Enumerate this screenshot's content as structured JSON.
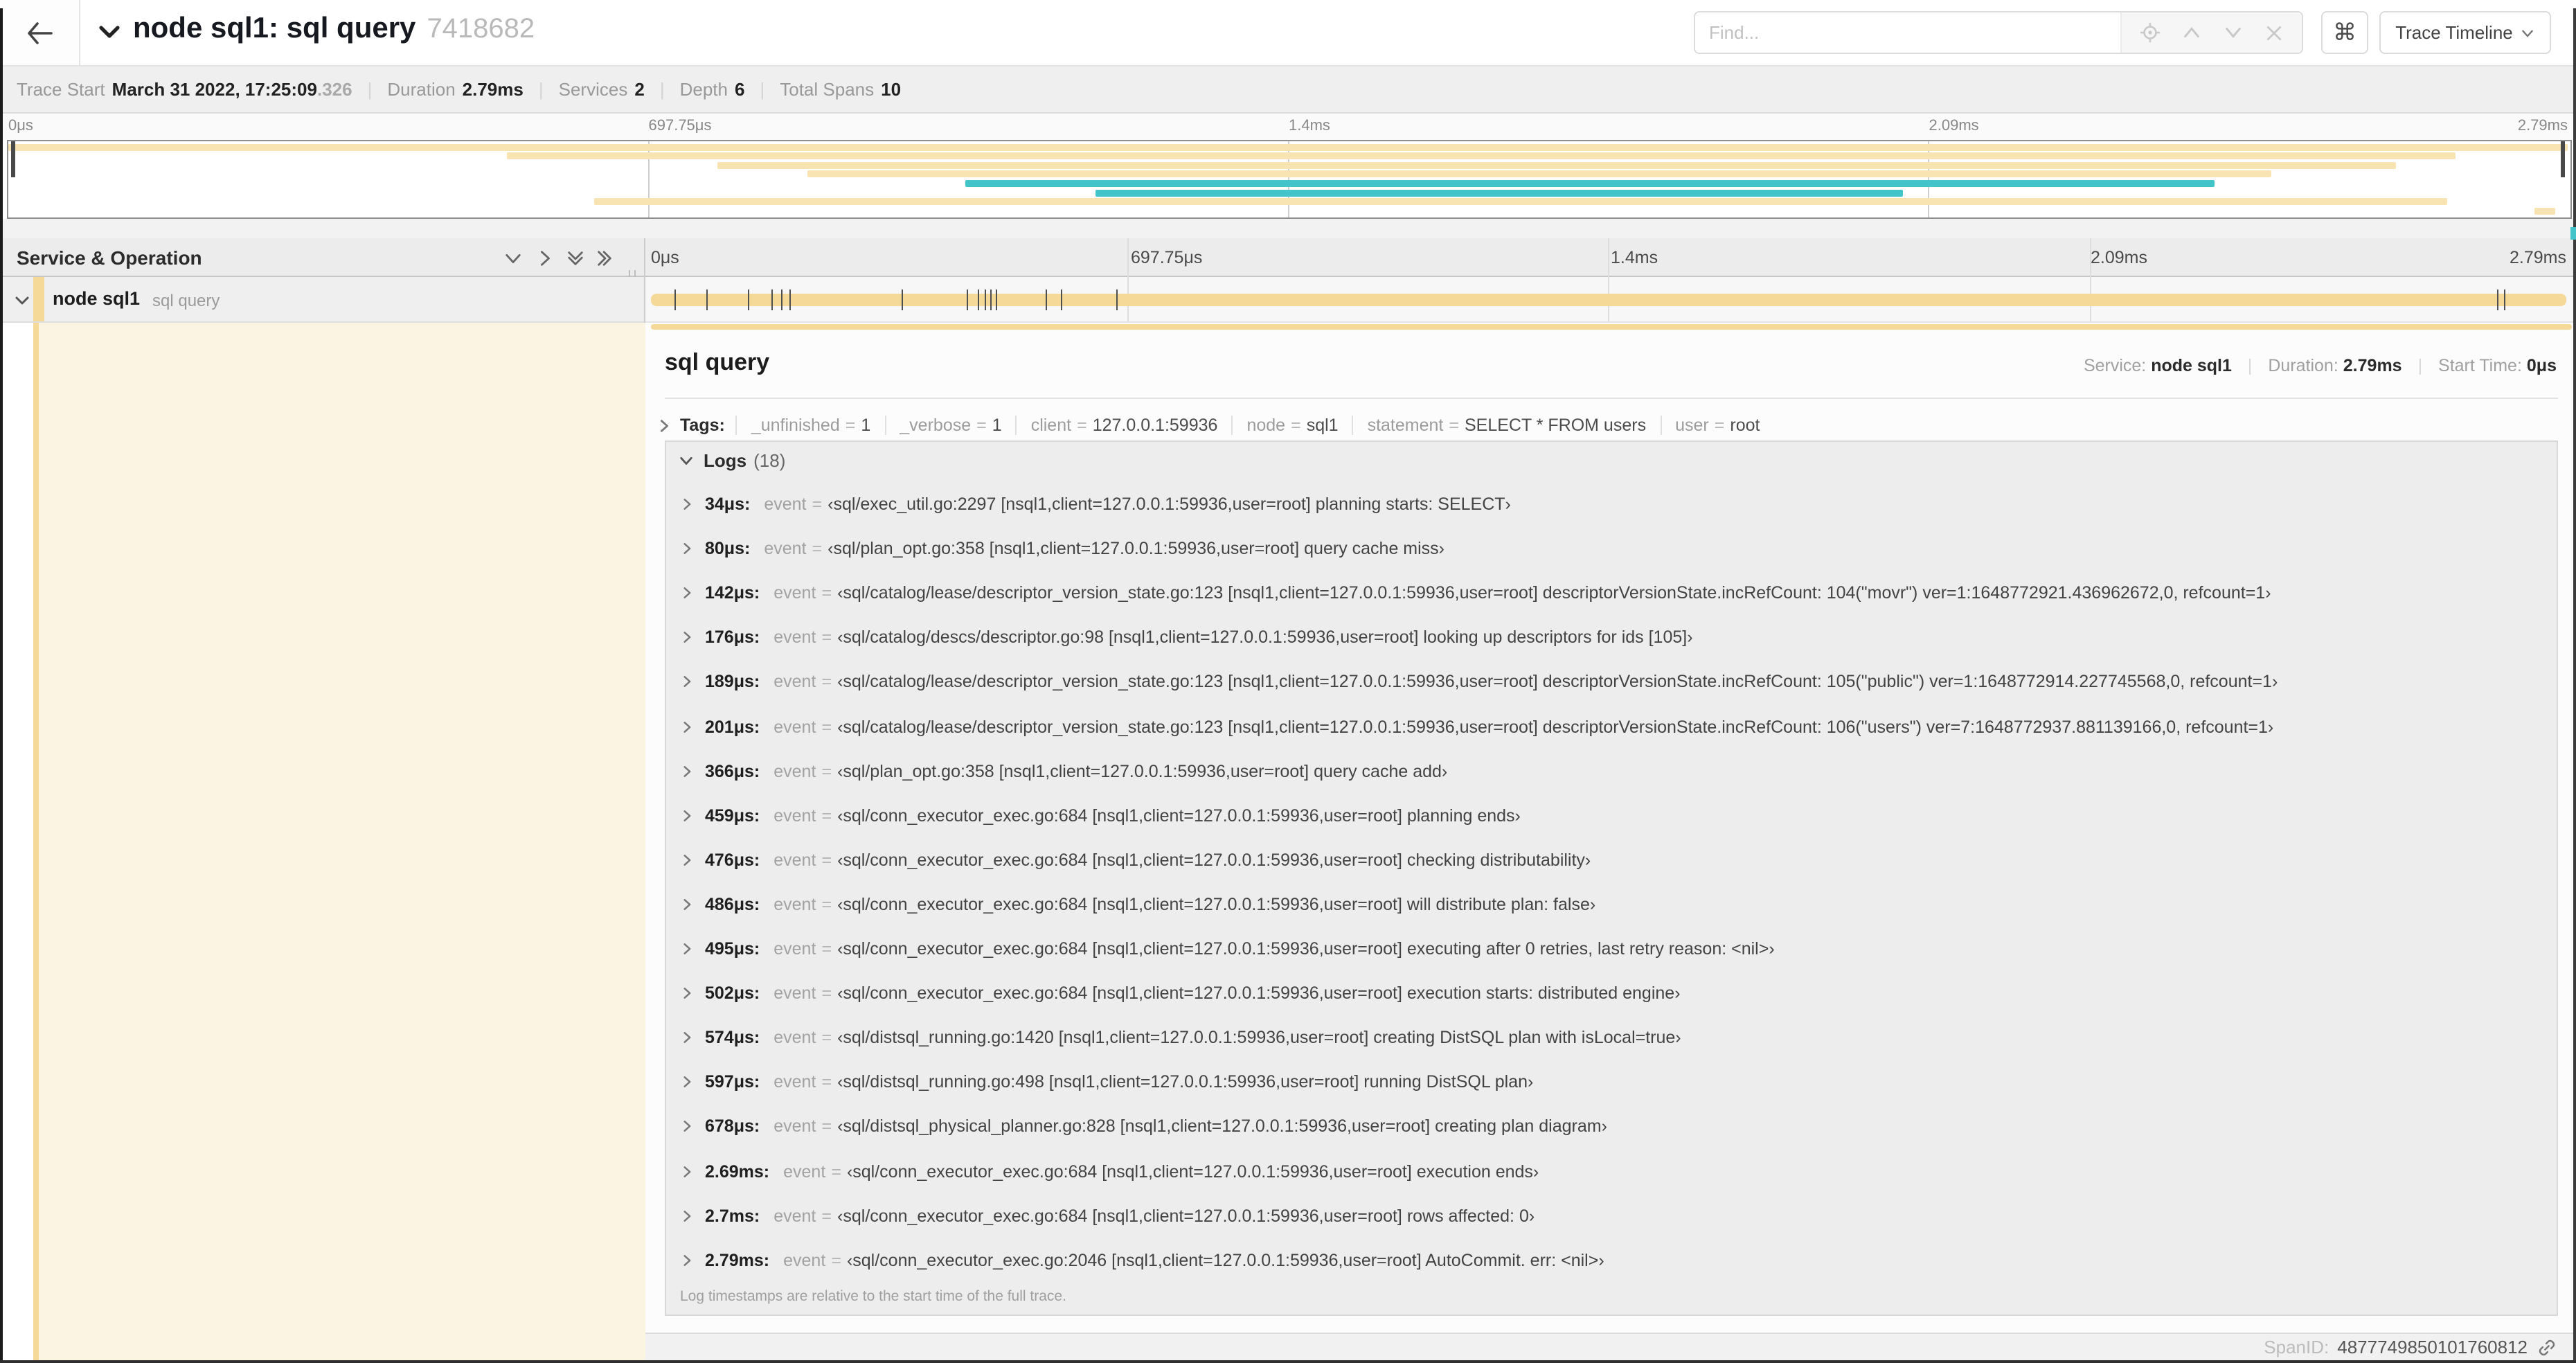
{
  "colors": {
    "tan": "#f5d998",
    "tan_light": "#f8e3b3",
    "teal": "#43c3ca",
    "cream": "#fcf4e3"
  },
  "header": {
    "title": "node sql1: sql query",
    "trace_id": "7418682",
    "find_placeholder": "Find...",
    "shortcut_glyph": "⌘",
    "view_selector": "Trace Timeline"
  },
  "meta": {
    "trace_start_label": "Trace Start",
    "trace_start": "March 31 2022, 17:25:09",
    "trace_start_fraction": ".326",
    "duration_label": "Duration",
    "duration": "2.79ms",
    "services_label": "Services",
    "services": "2",
    "depth_label": "Depth",
    "depth": "6",
    "total_spans_label": "Total Spans",
    "total_spans": "10"
  },
  "timeline": {
    "tick_labels": [
      "0μs",
      "697.75μs",
      "1.4ms",
      "2.09ms",
      "2.79ms"
    ],
    "duration_us": 2790,
    "log_marker_times_us": [
      34,
      80,
      142,
      176,
      189,
      201,
      366,
      459,
      476,
      486,
      495,
      502,
      574,
      597,
      678,
      2690,
      2700
    ]
  },
  "minimap": {
    "rows": [
      {
        "color": "tan_light",
        "start": 0.0,
        "end": 1.0
      },
      {
        "color": "tan_light",
        "start": 0.195,
        "end": 0.956
      },
      {
        "color": "tan_light",
        "start": 0.277,
        "end": 0.933
      },
      {
        "color": "tan_light",
        "start": 0.312,
        "end": 0.884
      },
      {
        "color": "teal",
        "start": 0.374,
        "end": 0.862
      },
      {
        "color": "teal",
        "start": 0.425,
        "end": 0.74
      },
      {
        "color": "tan_light",
        "start": 0.229,
        "end": 0.953
      },
      {
        "color": "tan_light",
        "start": 0.987,
        "end": 0.995
      }
    ]
  },
  "columns_header": {
    "label": "Service & Operation"
  },
  "row": {
    "service": "node sql1",
    "operation": "sql query"
  },
  "detail": {
    "title": "sql query",
    "service_label": "Service:",
    "service": "node sql1",
    "duration_label": "Duration:",
    "duration": "2.79ms",
    "start_label": "Start Time:",
    "start": "0μs",
    "tags_label": "Tags:",
    "tags": [
      {
        "key": "_unfinished",
        "value": "1"
      },
      {
        "key": "_verbose",
        "value": "1"
      },
      {
        "key": "client",
        "value": "127.0.0.1:59936"
      },
      {
        "key": "node",
        "value": "sql1"
      },
      {
        "key": "statement",
        "value": "SELECT * FROM users"
      },
      {
        "key": "user",
        "value": "root"
      }
    ],
    "logs_label": "Logs",
    "logs_count": "(18)",
    "log_field": "event",
    "logs": [
      {
        "time": "34μs:",
        "value": "‹sql/exec_util.go:2297 [nsql1,client=127.0.0.1:59936,user=root] planning starts: SELECT›"
      },
      {
        "time": "80μs:",
        "value": "‹sql/plan_opt.go:358 [nsql1,client=127.0.0.1:59936,user=root] query cache miss›"
      },
      {
        "time": "142μs:",
        "value": "‹sql/catalog/lease/descriptor_version_state.go:123 [nsql1,client=127.0.0.1:59936,user=root] descriptorVersionState.incRefCount: 104(\"movr\") ver=1:1648772921.436962672,0, refcount=1›"
      },
      {
        "time": "176μs:",
        "value": "‹sql/catalog/descs/descriptor.go:98 [nsql1,client=127.0.0.1:59936,user=root] looking up descriptors for ids [105]›"
      },
      {
        "time": "189μs:",
        "value": "‹sql/catalog/lease/descriptor_version_state.go:123 [nsql1,client=127.0.0.1:59936,user=root] descriptorVersionState.incRefCount: 105(\"public\") ver=1:1648772914.227745568,0, refcount=1›"
      },
      {
        "time": "201μs:",
        "value": "‹sql/catalog/lease/descriptor_version_state.go:123 [nsql1,client=127.0.0.1:59936,user=root] descriptorVersionState.incRefCount: 106(\"users\") ver=7:1648772937.881139166,0, refcount=1›"
      },
      {
        "time": "366μs:",
        "value": "‹sql/plan_opt.go:358 [nsql1,client=127.0.0.1:59936,user=root] query cache add›"
      },
      {
        "time": "459μs:",
        "value": "‹sql/conn_executor_exec.go:684 [nsql1,client=127.0.0.1:59936,user=root] planning ends›"
      },
      {
        "time": "476μs:",
        "value": "‹sql/conn_executor_exec.go:684 [nsql1,client=127.0.0.1:59936,user=root] checking distributability›"
      },
      {
        "time": "486μs:",
        "value": "‹sql/conn_executor_exec.go:684 [nsql1,client=127.0.0.1:59936,user=root] will distribute plan: false›"
      },
      {
        "time": "495μs:",
        "value": "‹sql/conn_executor_exec.go:684 [nsql1,client=127.0.0.1:59936,user=root] executing after 0 retries, last retry reason: <nil>›"
      },
      {
        "time": "502μs:",
        "value": "‹sql/conn_executor_exec.go:684 [nsql1,client=127.0.0.1:59936,user=root] execution starts: distributed engine›"
      },
      {
        "time": "574μs:",
        "value": "‹sql/distsql_running.go:1420 [nsql1,client=127.0.0.1:59936,user=root] creating DistSQL plan with isLocal=true›"
      },
      {
        "time": "597μs:",
        "value": "‹sql/distsql_running.go:498 [nsql1,client=127.0.0.1:59936,user=root] running DistSQL plan›"
      },
      {
        "time": "678μs:",
        "value": "‹sql/distsql_physical_planner.go:828 [nsql1,client=127.0.0.1:59936,user=root] creating plan diagram›"
      },
      {
        "time": "2.69ms:",
        "value": "‹sql/conn_executor_exec.go:684 [nsql1,client=127.0.0.1:59936,user=root] execution ends›"
      },
      {
        "time": "2.7ms:",
        "value": "‹sql/conn_executor_exec.go:684 [nsql1,client=127.0.0.1:59936,user=root] rows affected: 0›"
      },
      {
        "time": "2.79ms:",
        "value": "‹sql/conn_executor_exec.go:2046 [nsql1,client=127.0.0.1:59936,user=root] AutoCommit. err: <nil>›"
      }
    ],
    "logs_note": "Log timestamps are relative to the start time of the full trace.",
    "span_id_label": "SpanID:",
    "span_id": "4877749850101760812"
  }
}
